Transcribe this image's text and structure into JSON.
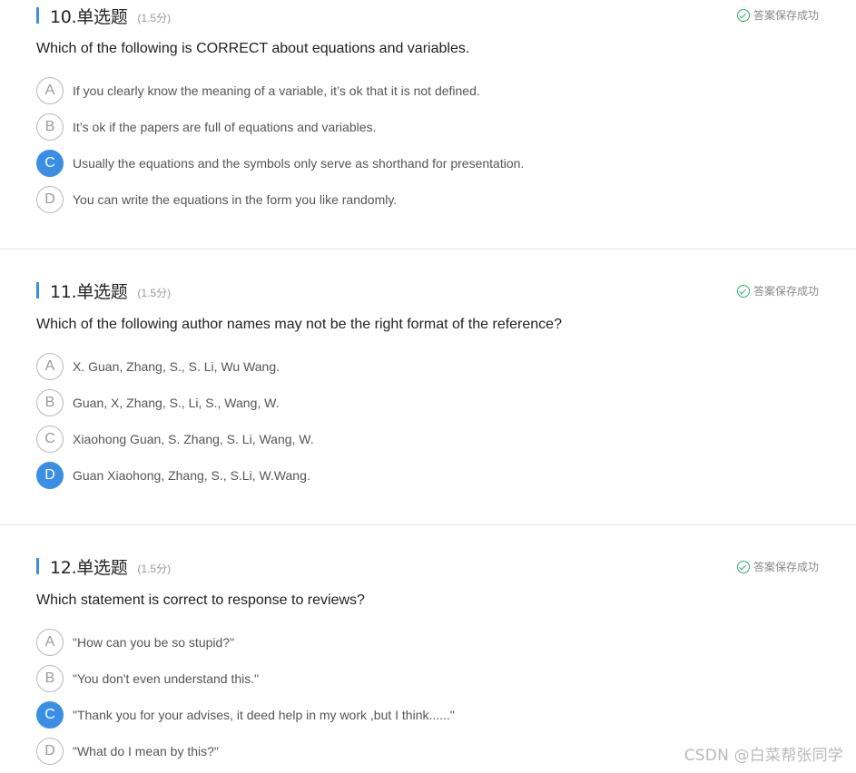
{
  "saved_text": "答案保存成功",
  "watermark": "CSDN @白菜帮张同学",
  "questions": [
    {
      "title": "10.单选题",
      "score": "(1.5分)",
      "text": "Which of the following is CORRECT about equations and variables.",
      "selected": "C",
      "options": [
        {
          "letter": "A",
          "text": "If you clearly know the meaning of a variable, it’s ok that it is not defined."
        },
        {
          "letter": "B",
          "text": "It’s ok if the papers are full of equations and variables."
        },
        {
          "letter": "C",
          "text": "Usually the equations and the symbols only serve as shorthand for presentation."
        },
        {
          "letter": "D",
          "text": "You can write the equations in the form you like randomly."
        }
      ]
    },
    {
      "title": "11.单选题",
      "score": "(1.5分)",
      "text": "Which of the following author names may not be the right format of the reference?",
      "selected": "D",
      "options": [
        {
          "letter": "A",
          "text": "X. Guan, Zhang, S., S. Li, Wu Wang."
        },
        {
          "letter": "B",
          "text": "Guan, X, Zhang, S., Li, S., Wang, W."
        },
        {
          "letter": "C",
          "text": "Xiaohong Guan, S. Zhang, S. Li, Wang, W."
        },
        {
          "letter": "D",
          "text": "Guan Xiaohong, Zhang, S., S.Li, W.Wang."
        }
      ]
    },
    {
      "title": "12.单选题",
      "score": "(1.5分)",
      "text": "Which statement is correct to response to reviews?",
      "selected": "C",
      "options": [
        {
          "letter": "A",
          "text": "\"How can you be so stupid?\""
        },
        {
          "letter": "B",
          "text": "\"You don't even understand this.\""
        },
        {
          "letter": "C",
          "text": "\"Thank you for your advises, it deed help in my work ,but I think......\""
        },
        {
          "letter": "D",
          "text": "\"What do I mean by this?\""
        }
      ]
    }
  ]
}
